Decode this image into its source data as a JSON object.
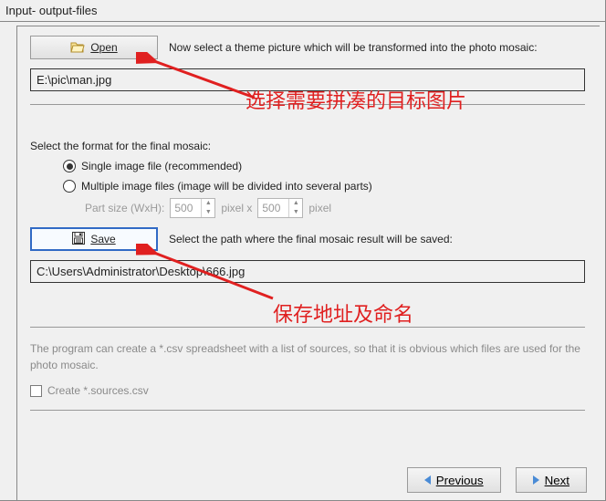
{
  "header": {
    "title": "Input- output-files"
  },
  "open": {
    "label": "Open",
    "instruction": "Now select a theme picture which will be transformed into the photo mosaic:",
    "path": "E:\\pic\\man.jpg"
  },
  "annotations": {
    "input": "选择需要拼凑的目标图片",
    "output": "保存地址及命名"
  },
  "format": {
    "label": "Select the format for the final mosaic:",
    "option_single": "Single image file (recommended)",
    "option_multiple": "Multiple image files (image will be divided into several parts)",
    "part_label": "Part size (WxH):",
    "part_w": "500",
    "part_h": "500",
    "px_x": "pixel x",
    "px": "pixel"
  },
  "save": {
    "label": "Save",
    "instruction": "Select the path where the final mosaic result will be saved:",
    "path": "C:\\Users\\Administrator\\Desktop\\666.jpg"
  },
  "csv": {
    "desc": "The program can create a *.csv spreadsheet with a list of sources, so that it is obvious which files are used for the photo mosaic.",
    "checkbox_label": "Create *.sources.csv"
  },
  "nav": {
    "prev": "Previous",
    "next": "Next"
  }
}
